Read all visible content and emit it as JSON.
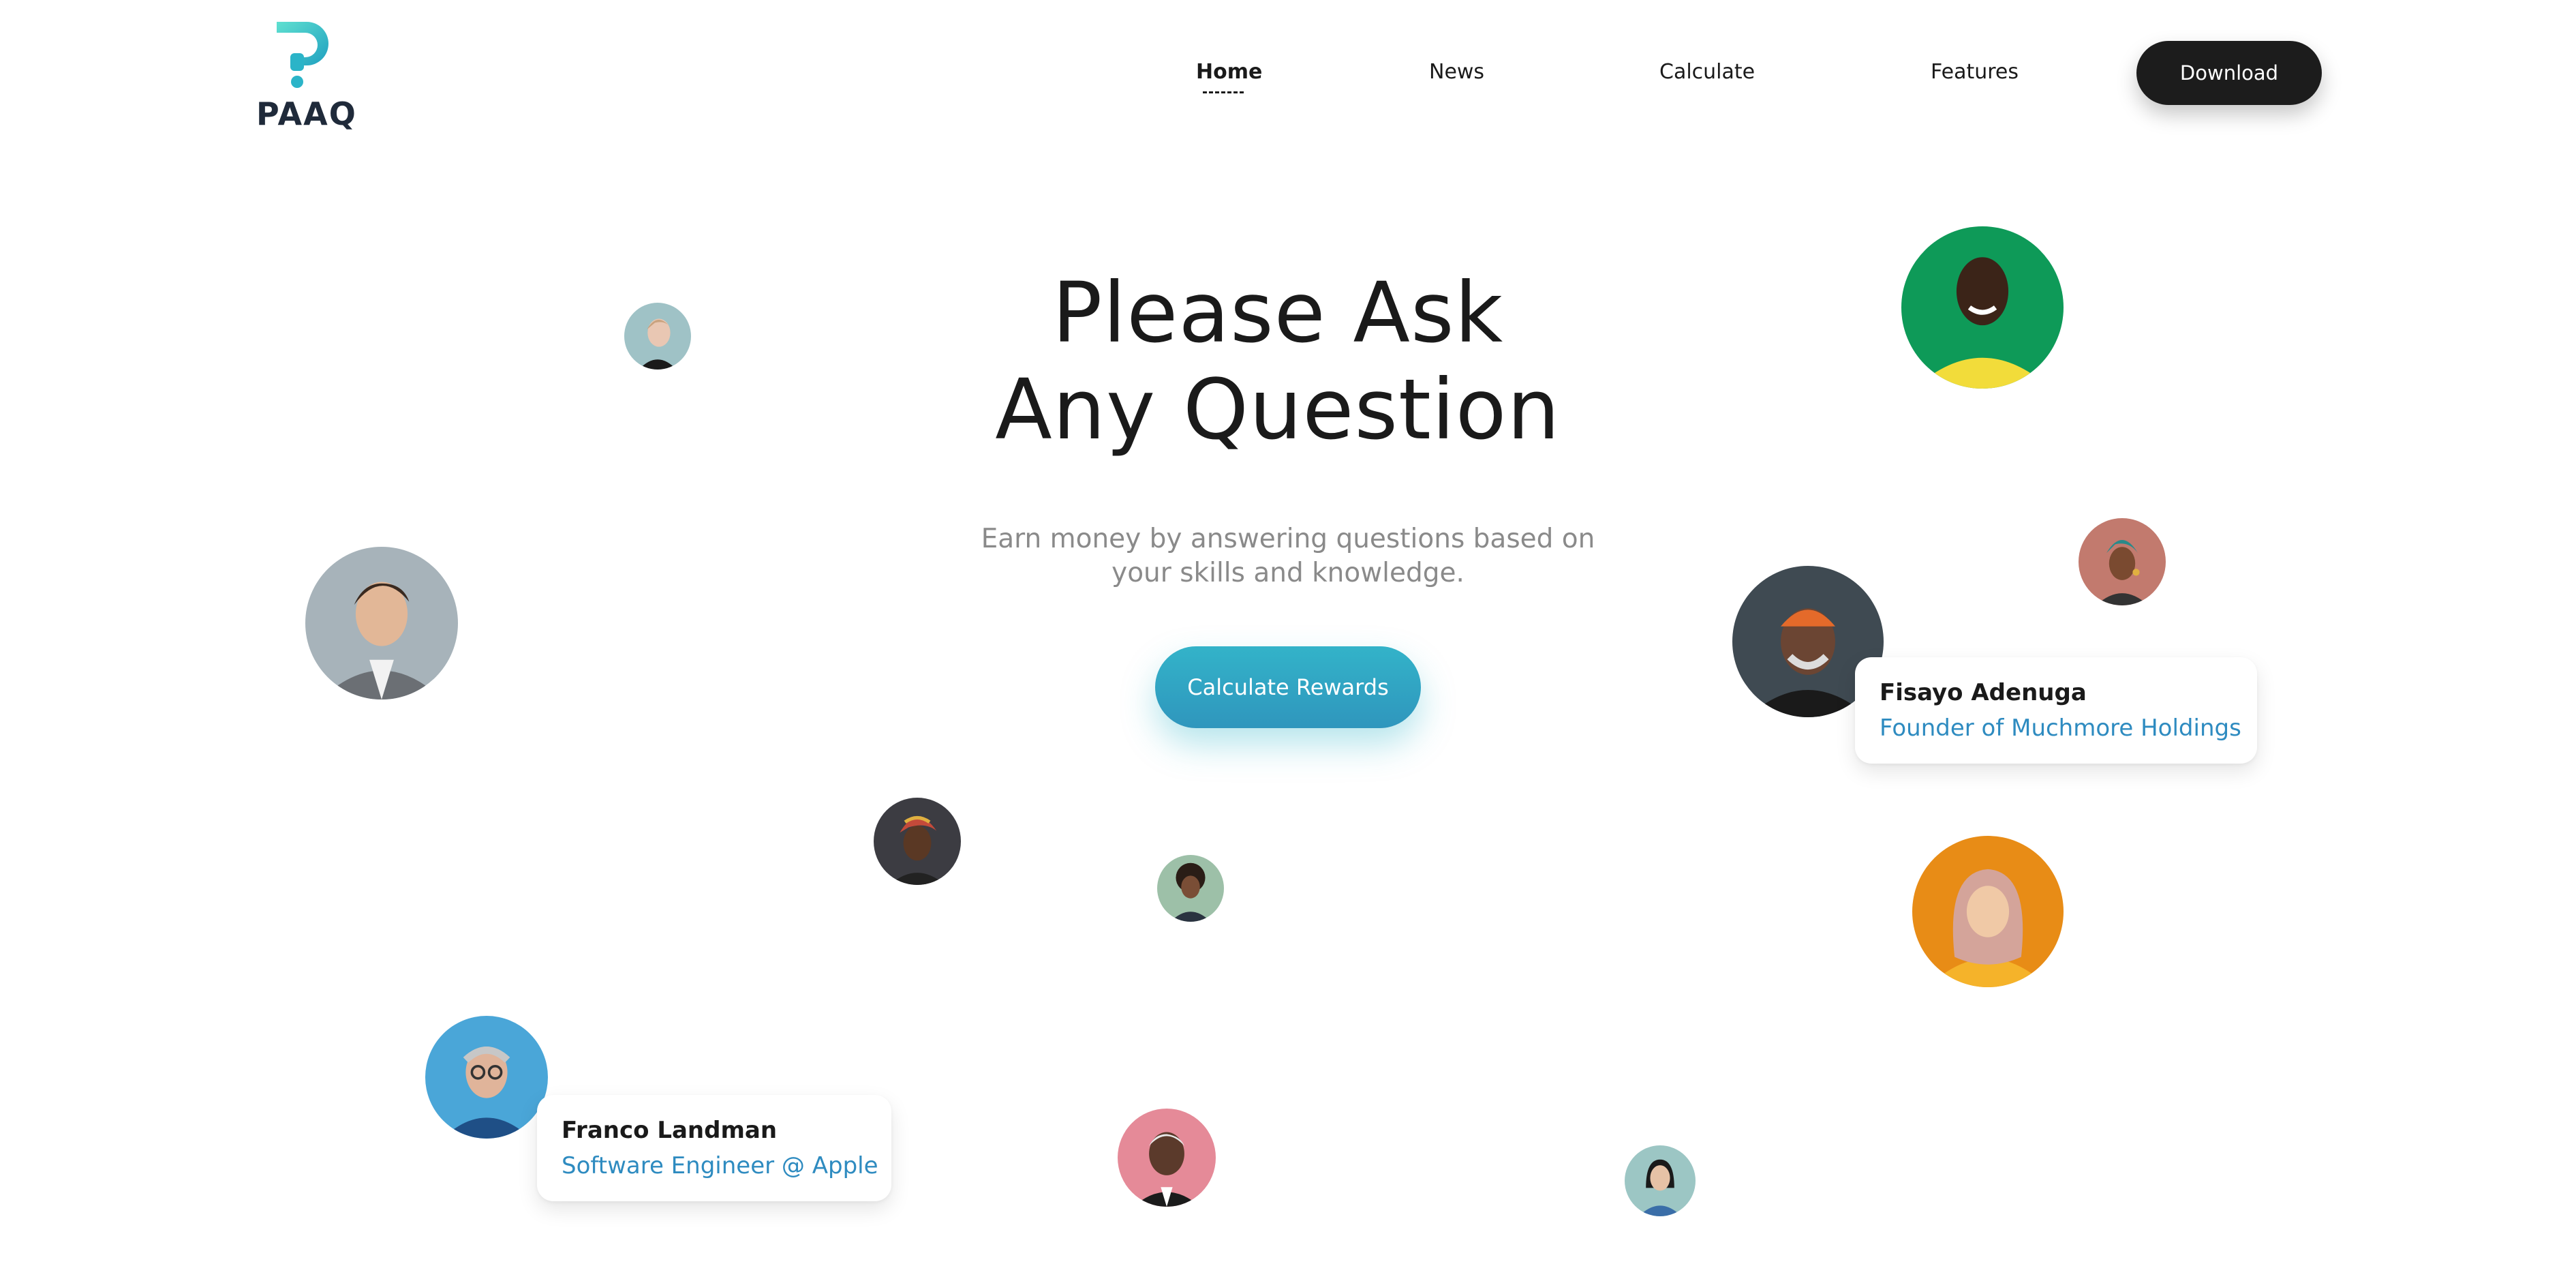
{
  "brand": {
    "name": "PAAQ",
    "accent": "#2bb4c8"
  },
  "nav": {
    "items": [
      {
        "label": "Home",
        "active": true
      },
      {
        "label": "News",
        "active": false
      },
      {
        "label": "Calculate",
        "active": false
      },
      {
        "label": "Features",
        "active": false
      }
    ],
    "download_label": "Download"
  },
  "hero": {
    "title_line1": "Please Ask",
    "title_line2": "Any Question",
    "subtitle_line1": "Earn money by answering questions based on",
    "subtitle_line2": "your skills and knowledge.",
    "cta_label": "Calculate Rewards"
  },
  "profiles": [
    {
      "name": "Fisayo Adenuga",
      "role": "Founder of Muchmore Holdings"
    },
    {
      "name": "Franco Landman",
      "role": "Software Engineer @ Apple"
    }
  ],
  "colors": {
    "dark": "#1c1c1c",
    "muted_text": "#8a8a8a",
    "role_text": "#2e8bc0",
    "cta_top": "#33b3c9",
    "cta_bottom": "#2f96bd"
  }
}
